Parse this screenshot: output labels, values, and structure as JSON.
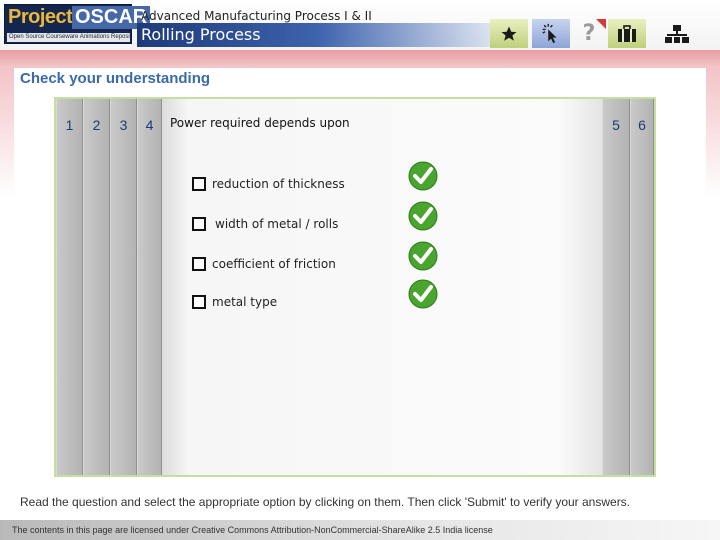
{
  "header": {
    "logo_project": "Project",
    "logo_oscar": "OSCAR",
    "logo_tagline": "Open Source Courseware Animations Repository",
    "course_title": "Advanced Manufacturing Process I & II",
    "topic_title": "Rolling Process",
    "help_symbol": "?",
    "icons": [
      "star-icon",
      "pointer-icon",
      "help-icon",
      "toolkit-icon",
      "tree-icon"
    ]
  },
  "section_title": "Check your understanding",
  "tabs_left": [
    "1",
    "2",
    "3",
    "4"
  ],
  "tabs_right": [
    "5",
    "6"
  ],
  "question": "Power required depends upon",
  "options": [
    {
      "label": "reduction of thickness",
      "checked": false,
      "correct": true
    },
    {
      "label": "width of metal / rolls",
      "checked": false,
      "correct": true
    },
    {
      "label": "coefficient of friction",
      "checked": false,
      "correct": true
    },
    {
      "label": "metal type",
      "checked": false,
      "correct": true
    }
  ],
  "instructions": "Read the question and select the appropriate option by clicking on them. Then click 'Submit' to verify your answers.",
  "license": "The contents in this page are licensed under Creative Commons Attribution-NonCommercial-ShareAlike 2.5 India license",
  "colors": {
    "accent": "#3a6ba7",
    "panel_border": "#c6dea0",
    "tick_green": "#4aa52e",
    "band_pink": "#e89ca2"
  }
}
